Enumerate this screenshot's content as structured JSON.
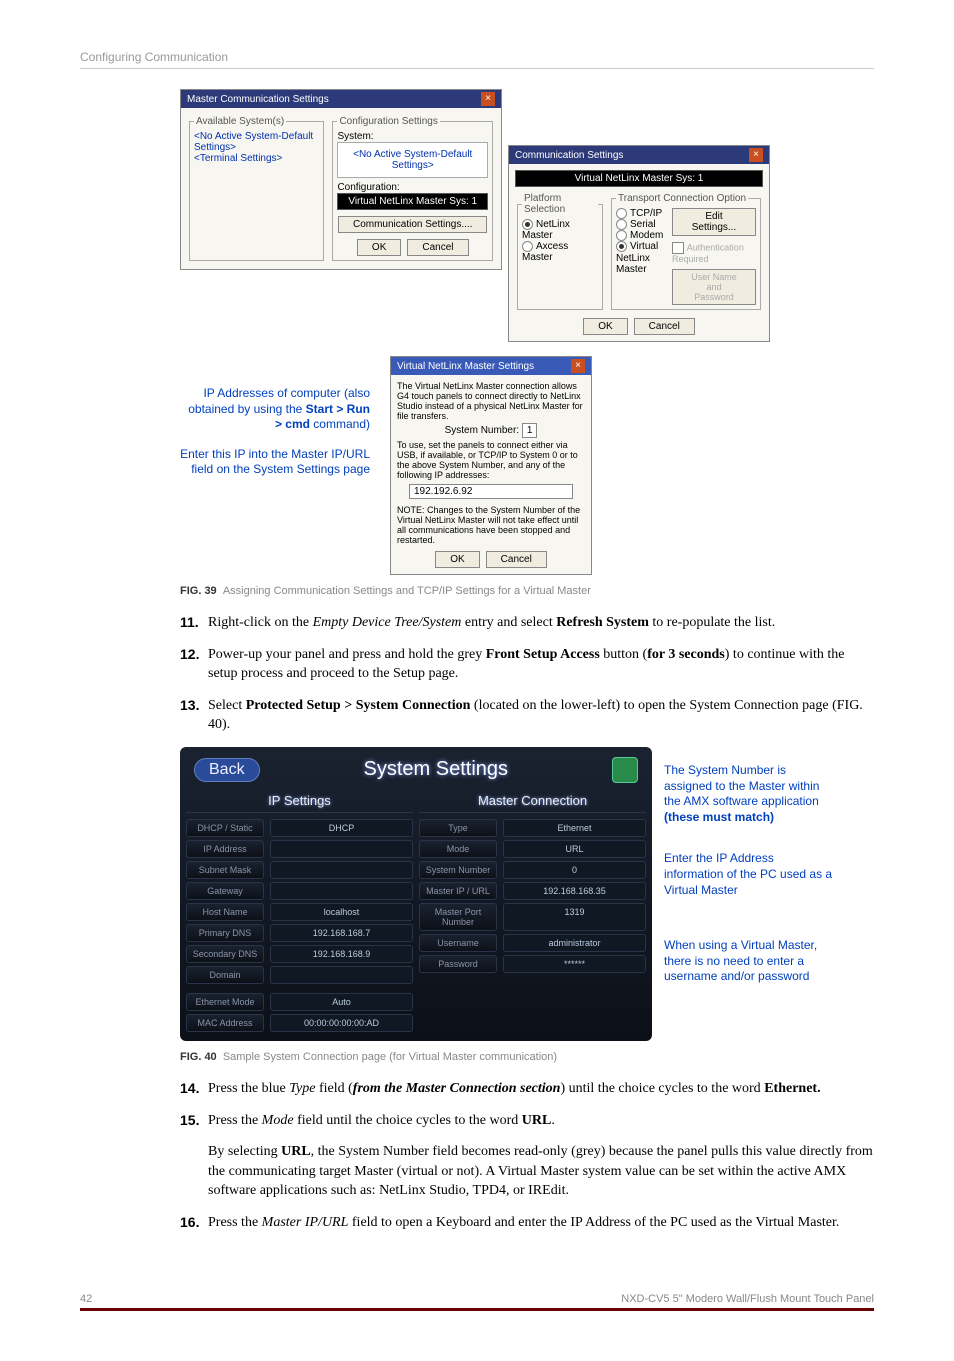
{
  "header": "Configuring Communication",
  "d1": {
    "title": "Master Communication Settings",
    "group_available": "Available System(s)",
    "avail1": "<No Active System-Default Settings>",
    "avail2": "<Terminal Settings>",
    "group_config": "Configuration Settings",
    "system_lbl": "System:",
    "system_val": "<No Active System-Default Settings>",
    "config_lbl": "Configuration:",
    "config_val": "Virtual NetLinx Master Sys: 1",
    "comm_btn": "Communication Settings....",
    "ok": "OK",
    "cancel": "Cancel"
  },
  "d2": {
    "title": "Communication Settings",
    "black_bar": "Virtual NetLinx Master Sys: 1",
    "platform": "Platform Selection",
    "p1": "NetLinx Master",
    "p2": "Axcess Master",
    "transport": "Transport Connection Option",
    "t1": "TCP/IP",
    "t2": "Serial",
    "t3": "Modem",
    "t4": "Virtual NetLinx Master",
    "edit": "Edit Settings...",
    "auth": "Authentication Required",
    "userpass": "User Name and Password",
    "ok": "OK",
    "cancel": "Cancel"
  },
  "d3": {
    "title": "Virtual NetLinx Master Settings",
    "desc": "The Virtual NetLinx Master connection allows G4 touch panels to connect directly to NetLinx Studio instead of a physical NetLinx Master for file transfers.",
    "sysnum_lbl": "System Number:",
    "sysnum_val": "1",
    "desc2": "To use, set the panels to connect either via USB, if available, or TCP/IP to System 0 or to the above System Number, and any of the following IP addresses:",
    "ip": "192.192.6.92",
    "note": "NOTE: Changes to the System Number of the Virtual NetLinx Master will not take effect until all communications have been stopped and restarted.",
    "ok": "OK",
    "cancel": "Cancel"
  },
  "ann_left_1": "IP Addresses of computer (also obtained by using the ",
  "ann_left_1b": "Start > Run > cmd",
  "ann_left_1c": " command)",
  "ann_left_2": "Enter this IP into the Master IP/URL field on the System Settings page",
  "fig39": "Assigning Communication Settings and TCP/IP Settings for a Virtual Master",
  "fig39_lbl": "FIG. 39",
  "steps": {
    "s11_a": "Right-click on the ",
    "s11_b": "Empty Device Tree/System",
    "s11_c": " entry and select ",
    "s11_d": "Refresh System",
    "s11_e": " to re-populate the list.",
    "s12_a": "Power-up your panel and press and hold the grey ",
    "s12_b": "Front Setup Access",
    "s12_c": " button (",
    "s12_d": "for 3 seconds",
    "s12_e": ") to continue with the setup process and proceed to the Setup page.",
    "s13_a": "Select ",
    "s13_b": "Protected Setup > System Connection",
    "s13_c": " (located on the lower-left) to open the System Connection page (FIG. 40).",
    "s14_a": "Press the blue ",
    "s14_b": "Type",
    "s14_c": " field (",
    "s14_d": "from the Master Connection section",
    "s14_e": ") until the choice cycles to the word ",
    "s14_f": "Ethernet.",
    "s15_a": "Press the ",
    "s15_b": "Mode",
    "s15_c": " field until the choice cycles to the word ",
    "s15_d": "URL",
    "s15_e": ".",
    "s15_cont_a": "By selecting ",
    "s15_cont_b": "URL",
    "s15_cont_c": ", the System Number field becomes read-only (grey) because the panel pulls this value directly from the communicating target Master (virtual or not). A Virtual Master system value can be set within the active AMX software applications such as: NetLinx Studio, TPD4, or IREdit.",
    "s16_a": "Press the ",
    "s16_b": "Master IP/URL",
    "s16_c": " field to open a Keyboard and enter the IP Address of the PC used as the Virtual Master."
  },
  "sys": {
    "back": "Back",
    "title": "System Settings",
    "ip_hdr": "IP Settings",
    "mc_hdr": "Master Connection",
    "l1": "DHCP / Static",
    "v1": "DHCP",
    "l2": "IP Address",
    "v2": "",
    "l3": "Subnet Mask",
    "v3": "",
    "l4": "Gateway",
    "v4": "",
    "l5": "Host Name",
    "v5": "localhost",
    "l6": "Primary DNS",
    "v6": "192.168.168.7",
    "l7": "Secondary DNS",
    "v7": "192.168.168.9",
    "l8": "Domain",
    "v8": "",
    "l9": "Ethernet Mode",
    "v9": "Auto",
    "l10": "MAC Address",
    "v10": "00:00:00:00:00:AD",
    "m1": "Type",
    "mv1": "Ethernet",
    "m2": "Mode",
    "mv2": "URL",
    "m3": "System Number",
    "mv3": "0",
    "m4": "Master IP / URL",
    "mv4": "192.168.168.35",
    "m5": "Master Port Number",
    "mv5": "1319",
    "m6": "Username",
    "mv6": "administrator",
    "m7": "Password",
    "mv7": "******"
  },
  "ann_r1": "The System Number is assigned to the Master within the AMX software application ",
  "ann_r1b": "(these must match)",
  "ann_r2": "Enter the IP Address information of the PC used as a Virtual Master",
  "ann_r3": "When using a Virtual Master, there is no need to enter a username and/or password",
  "fig40_lbl": "FIG. 40",
  "fig40": "Sample System Connection page (for Virtual Master communication)",
  "footer_page": "42",
  "footer_product": "NXD-CV5 5\" Modero Wall/Flush Mount Touch Panel"
}
